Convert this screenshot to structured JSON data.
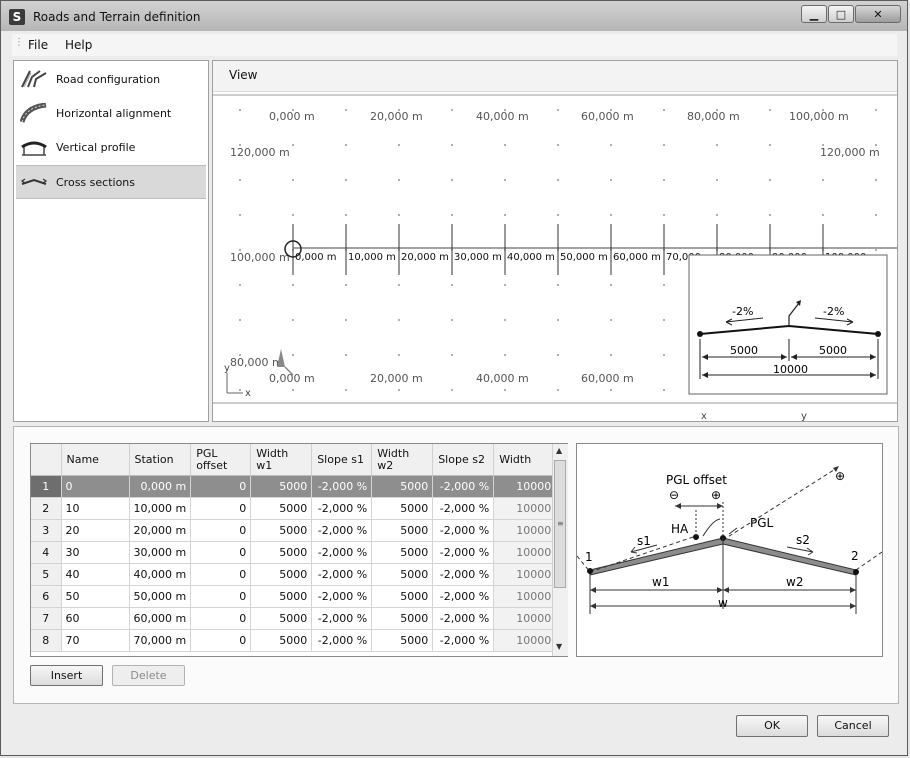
{
  "window": {
    "title": "Roads and Terrain definition",
    "app_icon": "S"
  },
  "menu": [
    "File",
    "Help"
  ],
  "nav": [
    {
      "label": "Road configuration",
      "icon": "road-configuration-icon"
    },
    {
      "label": "Horizontal alignment",
      "icon": "horizontal-alignment-icon"
    },
    {
      "label": "Vertical profile",
      "icon": "vertical-profile-icon"
    },
    {
      "label": "Cross sections",
      "icon": "cross-sections-icon",
      "selected": true
    }
  ],
  "view": {
    "title": "View",
    "top_ruler": [
      "0,000 m",
      "20,000 m",
      "40,000 m",
      "60,000 m",
      "80,000 m",
      "100,000 m"
    ],
    "bottom_ruler": [
      "0,000 m",
      "20,000 m",
      "40,000 m",
      "60,000 m"
    ],
    "left_labels": [
      "120,000 m",
      "100,000 m",
      "80,000 m"
    ],
    "right_label": "120,000 m",
    "stations": [
      "0,000 m",
      "10,000 m",
      "20,000 m",
      "30,000 m",
      "40,000 m",
      "50,000 m",
      "60,000 m",
      "70,000 m",
      "80,000 m",
      "90,000 m",
      "100,000 m"
    ],
    "axis_x": "x",
    "axis_y": "y",
    "bottom_axis_x": "x",
    "bottom_axis_y": "y",
    "inset": {
      "slope_left": "-2%",
      "slope_right": "-2%",
      "w1": "5000",
      "w2": "5000",
      "width": "10000"
    }
  },
  "table": {
    "columns": [
      "",
      "Name",
      "Station",
      "PGL\noffset",
      "Width w1",
      "Slope s1",
      "Width w2",
      "Slope s2",
      "Width"
    ],
    "rows": [
      [
        "1",
        "0",
        "0,000 m",
        "0",
        "5000",
        "-2,000 %",
        "5000",
        "-2,000 %",
        "10000"
      ],
      [
        "2",
        "10",
        "10,000 m",
        "0",
        "5000",
        "-2,000 %",
        "5000",
        "-2,000 %",
        "10000"
      ],
      [
        "3",
        "20",
        "20,000 m",
        "0",
        "5000",
        "-2,000 %",
        "5000",
        "-2,000 %",
        "10000"
      ],
      [
        "4",
        "30",
        "30,000 m",
        "0",
        "5000",
        "-2,000 %",
        "5000",
        "-2,000 %",
        "10000"
      ],
      [
        "5",
        "40",
        "40,000 m",
        "0",
        "5000",
        "-2,000 %",
        "5000",
        "-2,000 %",
        "10000"
      ],
      [
        "6",
        "50",
        "50,000 m",
        "0",
        "5000",
        "-2,000 %",
        "5000",
        "-2,000 %",
        "10000"
      ],
      [
        "7",
        "60",
        "60,000 m",
        "0",
        "5000",
        "-2,000 %",
        "5000",
        "-2,000 %",
        "10000"
      ],
      [
        "8",
        "70",
        "70,000 m",
        "0",
        "5000",
        "-2,000 %",
        "5000",
        "-2,000 %",
        "10000"
      ]
    ],
    "selected_row": 0
  },
  "buttons": {
    "insert": "Insert",
    "delete": "Delete",
    "ok": "OK",
    "cancel": "Cancel"
  },
  "diagram": {
    "pgl_offset": "PGL offset",
    "minus": "⊖",
    "plus": "⊕",
    "plus_far": "⊕",
    "ha": "HA",
    "pgl": "PGL",
    "s1": "s1",
    "s2": "s2",
    "w1": "w1",
    "w2": "w2",
    "w": "w",
    "p1": "1",
    "p2": "2"
  }
}
